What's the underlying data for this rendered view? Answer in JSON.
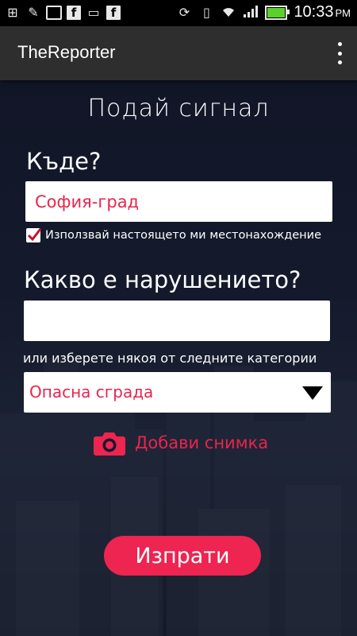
{
  "status_bar": {
    "time": "10:33",
    "ampm": "PM",
    "icons": [
      "add-icon",
      "edit-icon",
      "card-icon",
      "facebook-icon",
      "chat-icon",
      "facebook-icon",
      "sync-icon",
      "vibrate-icon",
      "wifi-icon",
      "signal-icon",
      "battery-icon"
    ]
  },
  "app_bar": {
    "title": "TheReporter"
  },
  "form": {
    "title": "Подай сигнал",
    "where_label": "Къде?",
    "location_value": "София-град",
    "use_location_label": "Използвай настоящето ми местонахождение",
    "use_location_checked": true,
    "what_label": "Какво е нарушението?",
    "violation_value": "",
    "or_categories_label": "или изберете някоя от следните категории",
    "category_selected": "Опасна сграда",
    "add_photo_label": "Добави снимка",
    "send_label": "Изпрати"
  },
  "colors": {
    "accent": "#ee2451",
    "accent_text": "#e8254d",
    "background": "#141a2c",
    "app_bar": "#2e2e2e"
  }
}
